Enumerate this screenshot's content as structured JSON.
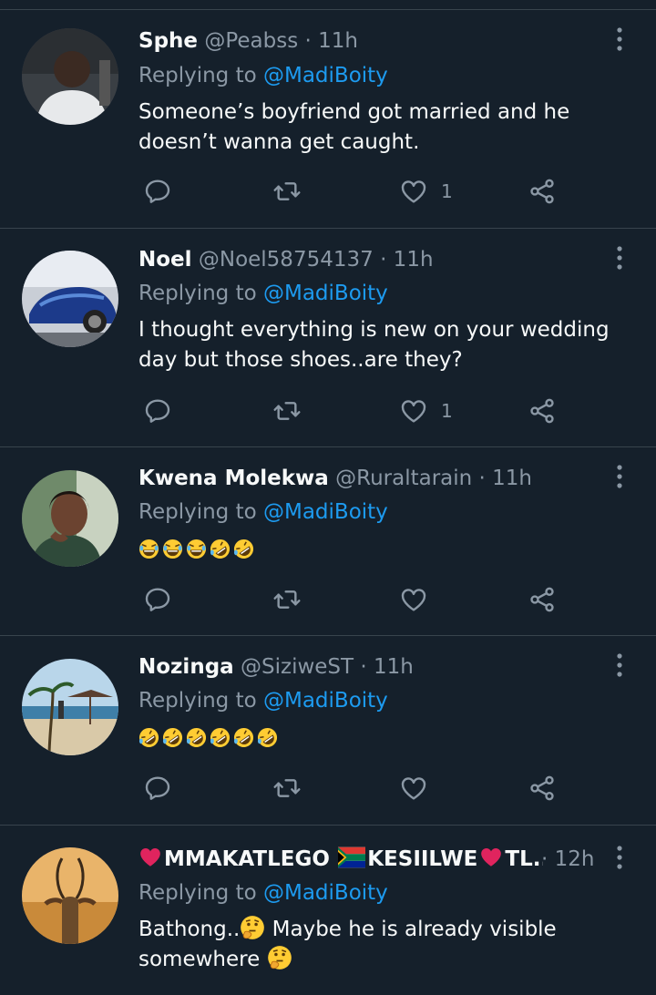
{
  "tweets": [
    {
      "name": "Sphe",
      "handle": "@Peabss",
      "time": "· 11h",
      "reply_prefix": "Replying to ",
      "reply_to": "@MadiBoity",
      "text": "Someone’s boyfriend got married and he doesn’t wanna get caught.",
      "likes": "1"
    },
    {
      "name": "Noel",
      "handle": "@Noel58754137",
      "time": "· 11h",
      "reply_prefix": "Replying to ",
      "reply_to": "@MadiBoity",
      "text": "I thought everything is new on your wedding day but those shoes..are they?",
      "likes": "1"
    },
    {
      "name": "Kwena Molekwa",
      "handle": "@Ruraltarain",
      "time": "· 11h",
      "reply_prefix": "Replying to ",
      "reply_to": "@MadiBoity",
      "text": "",
      "emojis": [
        "joy",
        "joy",
        "joy",
        "rofl",
        "rofl"
      ],
      "likes": ""
    },
    {
      "name": "Nozinga",
      "handle": "@SiziweST",
      "time": "· 11h",
      "reply_prefix": "Replying to ",
      "reply_to": "@MadiBoity",
      "text": "",
      "emojis": [
        "rofl",
        "rofl",
        "rofl",
        "rofl",
        "rofl",
        "rofl"
      ],
      "likes": ""
    },
    {
      "name": "MMAKATLEGO",
      "name_rest": "KESIILWE",
      "name_end": "TL...",
      "handle": "",
      "time": "· 12h",
      "reply_prefix": "Replying to ",
      "reply_to": "@MadiBoity",
      "text_a": "Bathong..",
      "text_b": " Maybe he is already visible somewhere ",
      "likes": ""
    }
  ],
  "icons": [
    "reply-icon",
    "retweet-icon",
    "like-icon",
    "share-icon",
    "more-icon"
  ],
  "colors": {
    "background": "#15202b",
    "accent": "#1d9bf0",
    "muted": "#8b98a5",
    "divider": "#38444d"
  }
}
